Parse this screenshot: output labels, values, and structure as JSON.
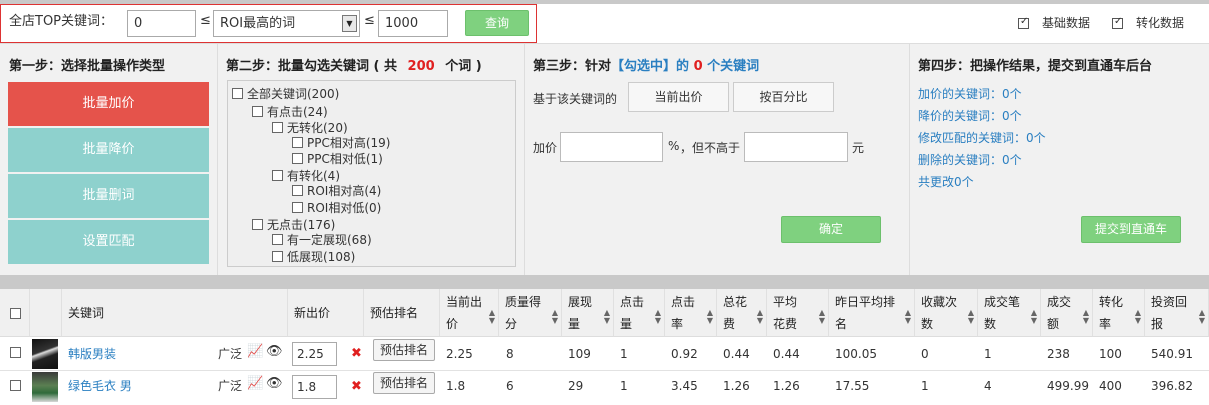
{
  "filter": {
    "label": "全店TOP关键词：",
    "min_value": "0",
    "le1": "≤",
    "select_value": "ROI最高的词",
    "le2": "≤",
    "max_value": "1000",
    "query_button": "查询"
  },
  "view_toggles": [
    {
      "label": "基础数据",
      "checked": true
    },
    {
      "label": "转化数据",
      "checked": true
    }
  ],
  "step1": {
    "title": "第一步：选择批量操作类型",
    "buttons": [
      "批量加价",
      "批量降价",
      "批量删词",
      "设置匹配"
    ],
    "active_color": "#e5534b",
    "inactive_color": "#8ed1cd"
  },
  "step2": {
    "title_prefix": "第二步：批量勾选关键词 ( 共",
    "count": "200",
    "title_suffix": "个词 )",
    "tree": [
      "全部关键词(200)",
      "有点击(24)",
      "无转化(20)",
      "PPC相对高(19)",
      "PPC相对低(1)",
      "有转化(4)",
      "ROI相对高(4)",
      "ROI相对低(0)",
      "无点击(176)",
      "有一定展现(68)",
      "低展现(108)"
    ]
  },
  "step3": {
    "title_prefix": "第三步：针对",
    "title_selected": "【勾选中】的",
    "title_count": "0",
    "title_suffix": "个关键词",
    "based_on": "基于该关键词的",
    "basis_buttons": [
      "当前出价",
      "按百分比"
    ],
    "raise_label": "加价",
    "percent": "%",
    "not_above": "，但不高于",
    "unit": "元",
    "confirm": "确定"
  },
  "step4": {
    "title": "第四步：把操作结果，提交到直通车后台",
    "links": [
      "加价的关键词：0个",
      "降价的关键词：0个",
      "修改匹配的关键词：0个",
      "删除的关键词：0个",
      "共更改0个"
    ],
    "submit": "提交到直通车"
  },
  "table": {
    "headers": [
      "关键词",
      "新出价",
      "预估排名",
      "当前出价",
      "质量得分",
      "展现量",
      "点击量",
      "点击率",
      "总花费",
      "平均花费",
      "昨日平均排名",
      "收藏次数",
      "成交笔数",
      "成交额",
      "转化率",
      "投资回报"
    ],
    "rows": [
      {
        "keyword": "韩版男装",
        "match": "广泛",
        "new_bid": "2.25",
        "estimate": "预估排名",
        "cells": [
          "2.25",
          "8",
          "109",
          "1",
          "0.92",
          "0.44",
          "0.44",
          "100.05",
          "0",
          "1",
          "238",
          "100",
          "540.91"
        ]
      },
      {
        "keyword": "绿色毛衣 男",
        "match": "广泛",
        "new_bid": "1.8",
        "estimate": "预估排名",
        "cells": [
          "1.8",
          "6",
          "29",
          "1",
          "3.45",
          "1.26",
          "1.26",
          "17.55",
          "1",
          "4",
          "499.99",
          "400",
          "396.82"
        ]
      }
    ]
  },
  "icons": [
    "checkbox-icon",
    "select-arrow-icon",
    "chart-icon",
    "eye-icon",
    "delete-icon",
    "sort-icon"
  ]
}
